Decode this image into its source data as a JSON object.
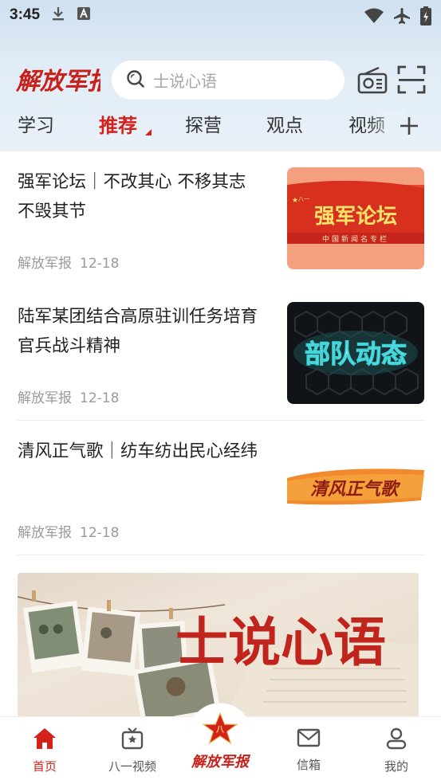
{
  "status_bar": {
    "time": "3:45"
  },
  "header": {
    "logo_text": "解放军报",
    "search_placeholder": "士说心语"
  },
  "tabs": [
    {
      "label": "学习"
    },
    {
      "label": "推荐",
      "active": true
    },
    {
      "label": "探营"
    },
    {
      "label": "观点"
    },
    {
      "label": "视频"
    }
  ],
  "news": [
    {
      "title": "强军论坛｜不改其心 不移其志 不毁其节",
      "source": "解放军报",
      "date": "12-18",
      "thumb_text": "强军论坛",
      "thumb_subtext": "中国新闻名专栏",
      "thumb_tag": "八一"
    },
    {
      "title": "陆军某团结合高原驻训任务培育官兵战斗精神",
      "source": "解放军报",
      "date": "12-18",
      "thumb_text": "部队动态"
    },
    {
      "title": "清风正气歌｜纺车纺出民心经纬",
      "source": "解放军报",
      "date": "12-18",
      "thumb_text": "清风正气歌"
    }
  ],
  "banner": {
    "text": "士说心语"
  },
  "bottom_nav": [
    {
      "label": "首页",
      "icon": "home-icon",
      "active": true
    },
    {
      "label": "八一视频",
      "icon": "tv-icon"
    },
    {
      "label": "解放军报",
      "icon": "star-logo-icon"
    },
    {
      "label": "信箱",
      "icon": "mail-icon"
    },
    {
      "label": "我的",
      "icon": "user-icon"
    }
  ],
  "colors": {
    "accent": "#d3221c",
    "header_bg": "#dce8f3"
  }
}
